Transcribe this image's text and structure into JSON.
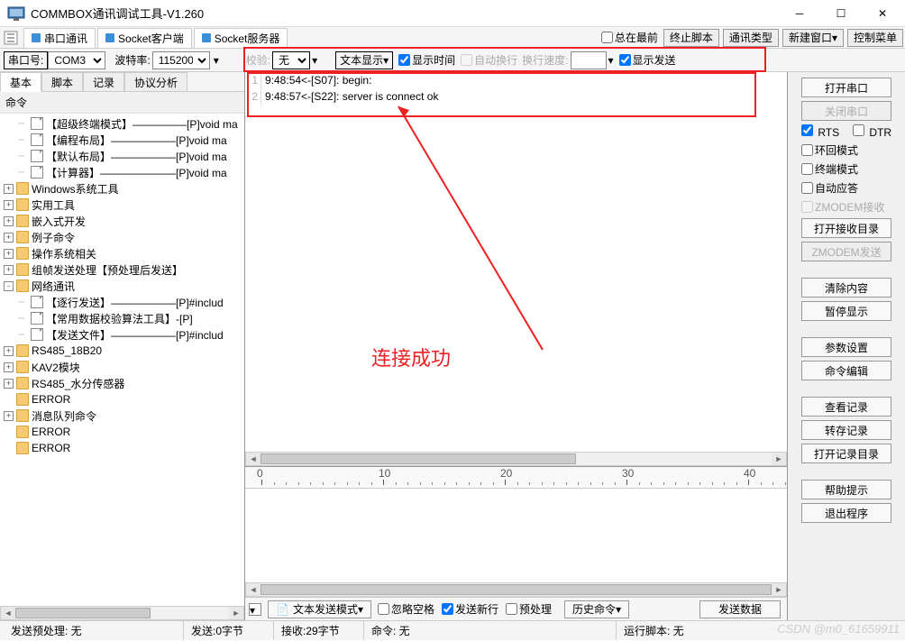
{
  "window": {
    "title": "COMMBOX通讯调试工具-V1.260"
  },
  "toptabs": {
    "serial": "串口通讯",
    "socket_client": "Socket客户端",
    "socket_server": "Socket服务器"
  },
  "topright": {
    "always_top": "总在最前",
    "end_script": "终止脚本",
    "comm_type": "通讯类型",
    "new_window": "新建窗口",
    "ctrl_menu": "控制菜单"
  },
  "cfg": {
    "port_label": "串口号:",
    "port_value": "COM3",
    "baud_label": "波特率:",
    "baud_value": "115200",
    "check_label": "校验:",
    "check_value": "无",
    "text_display": "文本显示",
    "show_time": "显示时间",
    "auto_wrap": "自动换行",
    "wrap_speed": "换行速度:",
    "show_send": "显示发送"
  },
  "lefttabs": {
    "basic": "基本",
    "script": "脚本",
    "record": "记录",
    "proto": "协议分析"
  },
  "left_header": "命令",
  "tree": [
    {
      "indent": 1,
      "type": "file",
      "label": "【超级终端模式】—————[P]void ma"
    },
    {
      "indent": 1,
      "type": "file",
      "label": "【编程布局】——————[P]void ma"
    },
    {
      "indent": 1,
      "type": "file",
      "label": "【默认布局】——————[P]void ma"
    },
    {
      "indent": 1,
      "type": "file",
      "label": "【计算器】———————[P]void ma"
    },
    {
      "indent": 0,
      "type": "folder",
      "exp": "+",
      "label": "Windows系统工具"
    },
    {
      "indent": 0,
      "type": "folder",
      "exp": "+",
      "label": "实用工具"
    },
    {
      "indent": 0,
      "type": "folder",
      "exp": "+",
      "label": "嵌入式开发"
    },
    {
      "indent": 0,
      "type": "folder",
      "exp": "+",
      "label": "例子命令"
    },
    {
      "indent": 0,
      "type": "folder",
      "exp": "+",
      "label": "操作系统相关"
    },
    {
      "indent": 0,
      "type": "folder",
      "exp": "+",
      "label": "组帧发送处理【预处理后发送】"
    },
    {
      "indent": 0,
      "type": "folder",
      "exp": "-",
      "label": "网络通讯"
    },
    {
      "indent": 1,
      "type": "file",
      "label": "【逐行发送】——————[P]#includ"
    },
    {
      "indent": 1,
      "type": "file",
      "label": "【常用数据校验算法工具】-[P]"
    },
    {
      "indent": 1,
      "type": "file",
      "label": "【发送文件】——————[P]#includ"
    },
    {
      "indent": 0,
      "type": "folder",
      "exp": "+",
      "label": "RS485_18B20"
    },
    {
      "indent": 0,
      "type": "folder",
      "exp": "+",
      "label": "KAV2模块"
    },
    {
      "indent": 0,
      "type": "folder",
      "exp": "+",
      "label": "RS485_水分传感器"
    },
    {
      "indent": 0,
      "type": "folder",
      "exp": "",
      "label": "ERROR"
    },
    {
      "indent": 0,
      "type": "folder",
      "exp": "+",
      "label": "消息队列命令"
    },
    {
      "indent": 0,
      "type": "folder",
      "exp": "",
      "label": "ERROR"
    },
    {
      "indent": 0,
      "type": "folder",
      "exp": "",
      "label": "ERROR"
    }
  ],
  "log": {
    "line1": "9:48:54<-[S07]: begin:",
    "line2": "9:48:57<-[S22]: server is connect ok"
  },
  "annotation": "连接成功",
  "ruler_ticks": [
    "0",
    "10",
    "20",
    "30",
    "40"
  ],
  "bottom": {
    "text_send_mode": "文本发送模式",
    "ignore_space": "忽略空格",
    "send_newline": "发送新行",
    "preprocess": "预处理",
    "history": "历史命令",
    "send_data": "发送数据"
  },
  "right": {
    "open_port": "打开串口",
    "close_port": "关闭串口",
    "rts": "RTS",
    "dtr": "DTR",
    "loop_mode": "环回模式",
    "terminal_mode": "终端模式",
    "auto_reply": "自动应答",
    "zmodem_recv": "ZMODEM接收",
    "open_recv_dir": "打开接收目录",
    "zmodem_send": "ZMODEM发送",
    "clear": "清除内容",
    "pause_display": "暂停显示",
    "param_setting": "参数设置",
    "cmd_edit": "命令编辑",
    "view_record": "查看记录",
    "save_record": "转存记录",
    "open_record_dir": "打开记录目录",
    "help": "帮助提示",
    "exit": "退出程序"
  },
  "status": {
    "preprocess": "发送预处理:  无",
    "sent": "发送:0字节",
    "recv": "接收:29字节",
    "cmd": "命令:  无",
    "run_script": "运行脚本:  无"
  },
  "watermark": "CSDN @m0_61659911"
}
